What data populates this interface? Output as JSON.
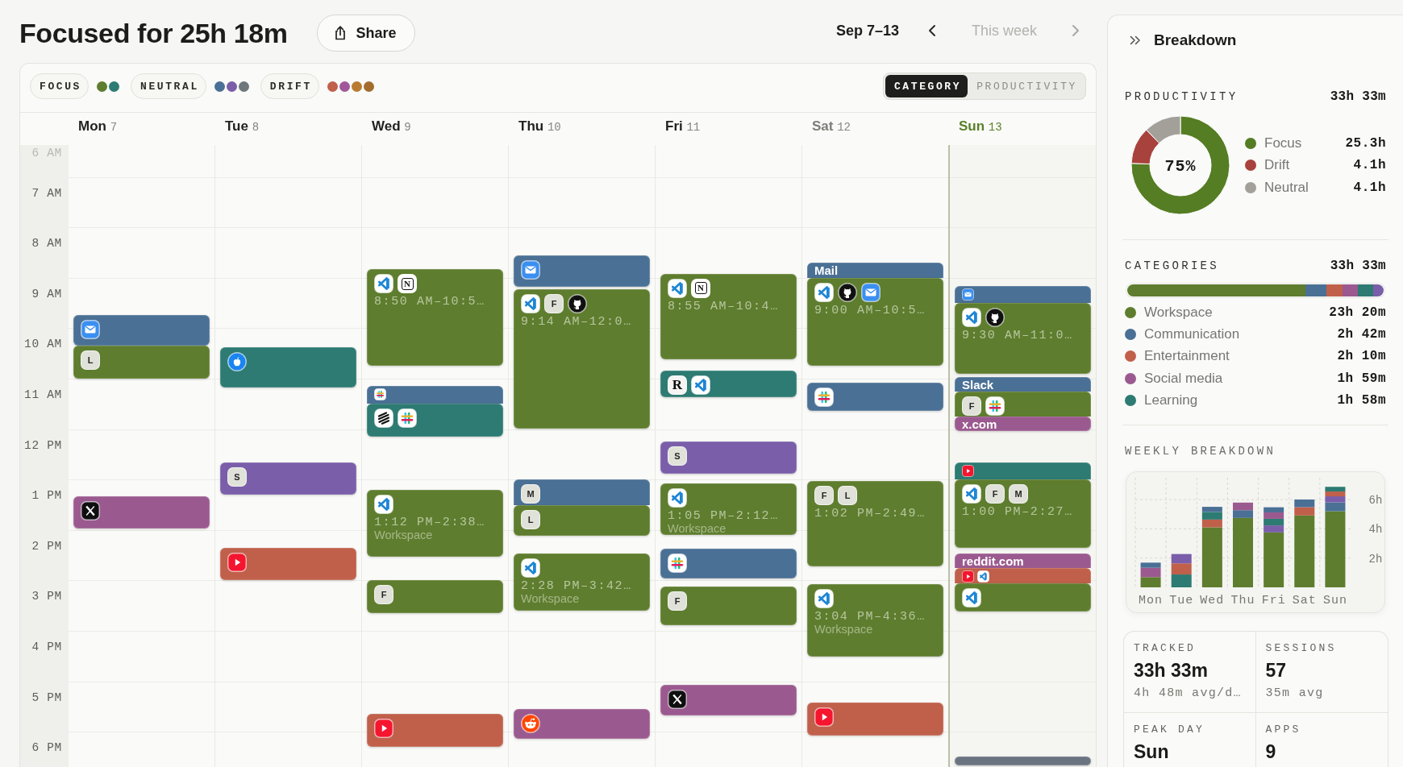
{
  "header": {
    "title": "Focused for 25h 18m",
    "share_label": "Share",
    "date_range": "Sep 7–13",
    "previous": {
      "disabled": false
    },
    "this_week": {
      "label": "This week",
      "disabled": true
    },
    "next": {
      "disabled": true
    }
  },
  "filters": [
    {
      "label": "FOCUS",
      "dots": [
        {
          "color": "#5e7d2e"
        },
        {
          "color": "#2d7b72"
        }
      ]
    },
    {
      "label": "NEUTRAL",
      "dots": [
        {
          "color": "#4a7095"
        },
        {
          "color": "#7a5ea9"
        },
        {
          "color": "#6e787c"
        }
      ]
    },
    {
      "label": "DRIFT",
      "dots": [
        {
          "color": "#c0604b"
        },
        {
          "color": "#a0589b"
        },
        {
          "color": "#b97a31"
        },
        {
          "color": "#a36c2e"
        }
      ]
    }
  ],
  "view_toggle": [
    {
      "label": "CATEGORY",
      "selected": true
    },
    {
      "label": "PRODUCTIVITY",
      "selected": false
    }
  ],
  "hours": [
    "6 AM",
    "7 AM",
    "8 AM",
    "9 AM",
    "10 AM",
    "11 AM",
    "12 PM",
    "1 PM",
    "2 PM",
    "3 PM",
    "4 PM",
    "5 PM",
    "6 PM"
  ],
  "days": [
    {
      "name": "Mon",
      "date": "7",
      "dimmed": false,
      "today": false,
      "events": [
        {
          "kind": "block",
          "color": "#4a7095",
          "icons": [
            {
              "kind": "envelope"
            }
          ]
        },
        {
          "kind": "block",
          "color": "#5e7d2e",
          "icons": [
            {
              "kind": "letter",
              "text": "L"
            }
          ]
        },
        {
          "kind": "block",
          "color": "#9b5a8f",
          "icons": [
            {
              "kind": "cross"
            }
          ]
        }
      ]
    },
    {
      "name": "Tue",
      "date": "8",
      "dimmed": false,
      "today": false,
      "events": [
        {
          "kind": "block",
          "color": "#2d7b72",
          "icons": [
            {
              "kind": "apple"
            }
          ]
        },
        {
          "kind": "block",
          "color": "#7a5ea9",
          "icons": [
            {
              "kind": "letter",
              "text": "S"
            }
          ]
        },
        {
          "kind": "block",
          "color": "#c0604b",
          "icons": [
            {
              "kind": "play"
            }
          ]
        }
      ]
    },
    {
      "name": "Wed",
      "date": "9",
      "dimmed": false,
      "today": false,
      "events": [
        {
          "kind": "block",
          "color": "#5e7d2e",
          "icons": [
            {
              "kind": "editor"
            },
            {
              "kind": "boxed",
              "text": "N"
            }
          ],
          "time": "8:50 AM–10:5…"
        },
        {
          "kind": "strip",
          "color": "#4a7095",
          "icons": [
            {
              "kind": "hash"
            }
          ]
        },
        {
          "kind": "block",
          "color": "#2d7b72",
          "icons": [
            {
              "kind": "stack"
            },
            {
              "kind": "hash"
            }
          ]
        },
        {
          "kind": "block",
          "color": "#5e7d2e",
          "icons": [
            {
              "kind": "editor"
            }
          ],
          "time": "1:12 PM–2:38…",
          "subtitle": "Workspace"
        },
        {
          "kind": "block",
          "color": "#5e7d2e",
          "icons": [
            {
              "kind": "letter",
              "text": "F"
            }
          ]
        },
        {
          "kind": "block",
          "color": "#c0604b",
          "icons": [
            {
              "kind": "play"
            }
          ]
        }
      ]
    },
    {
      "name": "Thu",
      "date": "10",
      "dimmed": false,
      "today": false,
      "events": [
        {
          "kind": "block",
          "color": "#4a7095",
          "icons": [
            {
              "kind": "envelope"
            }
          ]
        },
        {
          "kind": "block",
          "color": "#5e7d2e",
          "icons": [
            {
              "kind": "editor"
            },
            {
              "kind": "letter",
              "text": "F"
            },
            {
              "kind": "octocat"
            }
          ],
          "time": "9:14 AM–12:0…"
        },
        {
          "kind": "block",
          "color": "#4a7095",
          "icons": [
            {
              "kind": "letter",
              "text": "M"
            }
          ]
        },
        {
          "kind": "block",
          "color": "#5e7d2e",
          "icons": [
            {
              "kind": "letter",
              "text": "L"
            }
          ]
        },
        {
          "kind": "block",
          "color": "#5e7d2e",
          "icons": [
            {
              "kind": "editor"
            }
          ],
          "time": "2:28 PM–3:42…",
          "subtitle": "Workspace"
        },
        {
          "kind": "block",
          "color": "#9b5a8f",
          "icons": [
            {
              "kind": "alien"
            }
          ]
        }
      ]
    },
    {
      "name": "Fri",
      "date": "11",
      "dimmed": false,
      "today": false,
      "events": [
        {
          "kind": "block",
          "color": "#5e7d2e",
          "icons": [
            {
              "kind": "editor"
            },
            {
              "kind": "boxed",
              "text": "N"
            }
          ],
          "time": "8:55 AM–10:4…"
        },
        {
          "kind": "block",
          "color": "#2d7b72",
          "icons": [
            {
              "kind": "serif",
              "text": "R"
            },
            {
              "kind": "editor"
            }
          ]
        },
        {
          "kind": "block",
          "color": "#7a5ea9",
          "icons": [
            {
              "kind": "letter",
              "text": "S"
            }
          ]
        },
        {
          "kind": "block",
          "color": "#5e7d2e",
          "icons": [
            {
              "kind": "editor"
            }
          ],
          "time": "1:05 PM–2:12…",
          "subtitle": "Workspace"
        },
        {
          "kind": "block",
          "color": "#4a7095",
          "icons": [
            {
              "kind": "hash"
            }
          ]
        },
        {
          "kind": "block",
          "color": "#5e7d2e",
          "icons": [
            {
              "kind": "letter",
              "text": "F"
            }
          ]
        },
        {
          "kind": "block",
          "color": "#9b5a8f",
          "icons": [
            {
              "kind": "cross"
            }
          ]
        }
      ]
    },
    {
      "name": "Sat",
      "date": "12",
      "dimmed": true,
      "today": false,
      "events": [
        {
          "kind": "strip",
          "color": "#4a7095",
          "title": "Mail"
        },
        {
          "kind": "block",
          "color": "#5e7d2e",
          "icons": [
            {
              "kind": "editor"
            },
            {
              "kind": "octocat"
            },
            {
              "kind": "envelope"
            }
          ],
          "time": "9:00 AM–10:5…"
        },
        {
          "kind": "block",
          "color": "#4a7095",
          "icons": [
            {
              "kind": "hash"
            }
          ]
        },
        {
          "kind": "block",
          "color": "#5e7d2e",
          "icons": [
            {
              "kind": "letter",
              "text": "F"
            },
            {
              "kind": "letter",
              "text": "L"
            }
          ],
          "time": "1:02 PM–2:49…"
        },
        {
          "kind": "block",
          "color": "#5e7d2e",
          "icons": [
            {
              "kind": "editor"
            }
          ],
          "time": "3:04 PM–4:36…",
          "subtitle": "Workspace"
        },
        {
          "kind": "block",
          "color": "#c0604b",
          "icons": [
            {
              "kind": "play"
            }
          ]
        }
      ]
    },
    {
      "name": "Sun",
      "date": "13",
      "dimmed": false,
      "today": true,
      "events": [
        {
          "kind": "strip",
          "color": "#4a7095",
          "icons": [
            {
              "kind": "envelope"
            }
          ]
        },
        {
          "kind": "block",
          "color": "#5e7d2e",
          "icons": [
            {
              "kind": "editor"
            },
            {
              "kind": "octocat"
            }
          ],
          "time": "9:30 AM–11:0…"
        },
        {
          "kind": "strip",
          "color": "#4a7095",
          "title": "Slack"
        },
        {
          "kind": "block",
          "color": "#5e7d2e",
          "icons": [
            {
              "kind": "letter",
              "text": "F"
            },
            {
              "kind": "hash"
            }
          ]
        },
        {
          "kind": "strip",
          "color": "#9b5a8f",
          "title": "x.com"
        },
        {
          "kind": "strip",
          "color": "#2d7b72",
          "icons": [
            {
              "kind": "play"
            }
          ]
        },
        {
          "kind": "block",
          "color": "#5e7d2e",
          "icons": [
            {
              "kind": "editor"
            },
            {
              "kind": "letter",
              "text": "F"
            },
            {
              "kind": "letter",
              "text": "M"
            }
          ],
          "time": "1:00 PM–2:27…"
        },
        {
          "kind": "strip",
          "color": "#9b5a8f",
          "title": "reddit.com"
        },
        {
          "kind": "strip",
          "color": "#c0604b",
          "icons": [
            {
              "kind": "play"
            },
            {
              "kind": "editor"
            }
          ]
        },
        {
          "kind": "block",
          "color": "#5e7d2e",
          "icons": [
            {
              "kind": "editor"
            }
          ]
        },
        {
          "kind": "strip",
          "color": "#6a7480"
        }
      ]
    }
  ],
  "breakdown": {
    "title": "Breakdown",
    "productivity": {
      "label": "PRODUCTIVITY",
      "total": "33h 33m",
      "center_label": "75%",
      "chart_data": {
        "type": "donut",
        "values": [
          75.6,
          12.2,
          12.2
        ]
      },
      "legend": [
        {
          "label": "Focus",
          "value": "25.3h",
          "color": "#557d23"
        },
        {
          "label": "Drift",
          "value": "4.1h",
          "color": "#a8423c"
        },
        {
          "label": "Neutral",
          "value": "4.1h",
          "color": "#a3a099"
        }
      ]
    },
    "categories": {
      "label": "CATEGORIES",
      "total": "33h 33m",
      "bar": [
        {
          "color": "#5e7d2e"
        },
        {
          "color": "#4a7095"
        },
        {
          "color": "#c0604b"
        },
        {
          "color": "#9b5a8f"
        },
        {
          "color": "#2d7b72"
        },
        {
          "color": "#7a5ea9"
        }
      ],
      "items": [
        {
          "label": "Workspace",
          "value": "23h 20m",
          "color": "#5e7d2e"
        },
        {
          "label": "Communication",
          "value": "2h 42m",
          "color": "#4a7095"
        },
        {
          "label": "Entertainment",
          "value": "2h 10m",
          "color": "#c0604b"
        },
        {
          "label": "Social media",
          "value": "1h 59m",
          "color": "#9b5a8f"
        },
        {
          "label": "Learning",
          "value": "1h 58m",
          "color": "#2d7b72"
        }
      ]
    },
    "weekly": {
      "label": "WEEKLY BREAKDOWN",
      "chart_data": {
        "type": "bar",
        "stacked": true,
        "grid": true,
        "categories": [
          "Mon",
          "Tue",
          "Wed",
          "Thu",
          "Fri",
          "Sat",
          "Sun"
        ],
        "ylim": [
          0,
          7.5
        ],
        "yticks": [
          {
            "value": 2,
            "label": "2h"
          },
          {
            "value": 4,
            "label": "4h"
          },
          {
            "value": 6,
            "label": "6h"
          }
        ],
        "series": [
          {
            "color": "#5e7d2e",
            "values": [
              0.7,
              0,
              4.11,
              4.75,
              3.76,
              4.92,
              5.21
            ]
          },
          {
            "color": "#4a7095",
            "values": [
              0.35,
              0,
              0.35,
              0.53,
              0.35,
              0.52,
              0.61
            ]
          },
          {
            "color": "#c0604b",
            "values": [
              0,
              0.76,
              0.53,
              0,
              0,
              0.57,
              0.33
            ]
          },
          {
            "color": "#9b5a8f",
            "values": [
              0.64,
              0,
              0,
              0.52,
              0.44,
              0,
              0
            ]
          },
          {
            "color": "#2d7b72",
            "values": [
              0,
              0.88,
              0.52,
              0,
              0.45,
              0,
              0.32
            ]
          },
          {
            "color": "#7a5ea9",
            "values": [
              0,
              0.64,
              0,
              0,
              0.48,
              0,
              0.41
            ]
          }
        ]
      }
    },
    "stats": [
      {
        "label": "TRACKED",
        "value": "33h 33m",
        "note": "4h 48m avg/d…"
      },
      {
        "label": "SESSIONS",
        "value": "57",
        "note": "35m avg"
      },
      {
        "label": "PEAK DAY",
        "value": "Sun"
      },
      {
        "label": "APPS",
        "value": "9"
      }
    ]
  }
}
